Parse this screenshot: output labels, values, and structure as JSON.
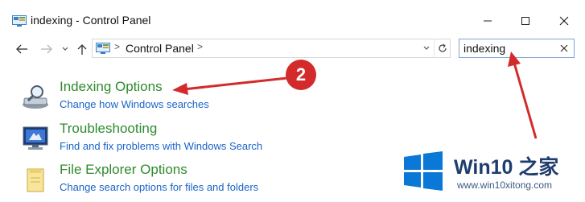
{
  "window": {
    "title": "indexing - Control Panel",
    "controls": [
      "minimize",
      "maximize",
      "close"
    ]
  },
  "address": {
    "breadcrumb": "Control Panel",
    "separator": ">"
  },
  "search": {
    "value": "indexing"
  },
  "results": [
    {
      "title": "Indexing Options",
      "subtitle": "Change how Windows searches",
      "icon": "indexing-options-icon"
    },
    {
      "title": "Troubleshooting",
      "subtitle": "Find and fix problems with Windows Search",
      "icon": "troubleshooting-icon"
    },
    {
      "title": "File Explorer Options",
      "subtitle": "Change search options for files and folders",
      "icon": "folder-options-icon"
    }
  ],
  "annotation": {
    "badge": "2",
    "color": "#d32b2b"
  },
  "watermark": {
    "brand": "Win10 之家",
    "url": "www.win10xitong.com"
  },
  "colors": {
    "result_title": "#2e8b2e",
    "result_subtitle": "#1a64c8",
    "search_border": "#7aa7d6",
    "win_blue": "#0a78d7"
  }
}
